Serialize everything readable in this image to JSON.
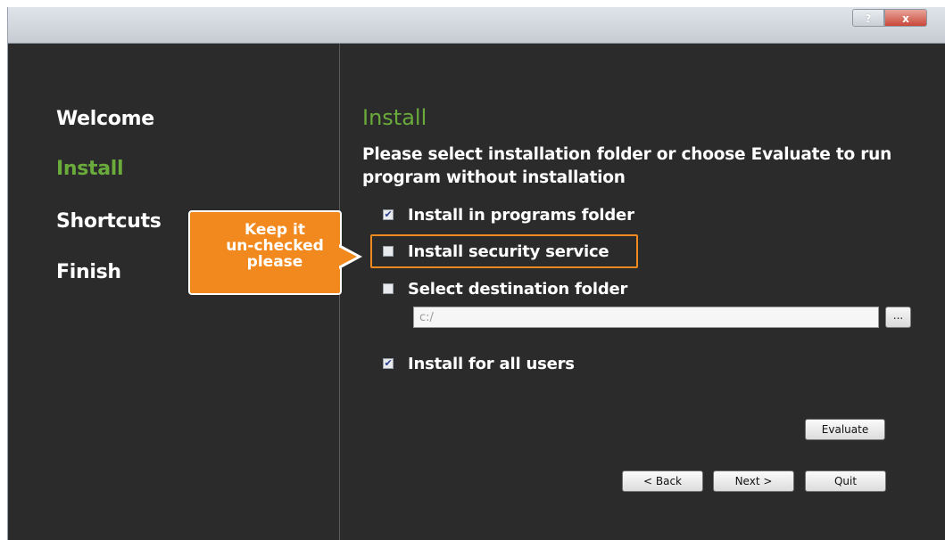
{
  "titlebar": {
    "help_label": "?",
    "close_label": "x"
  },
  "sidebar": {
    "items": [
      {
        "label": "Welcome",
        "active": false
      },
      {
        "label": "Install",
        "active": true
      },
      {
        "label": "Shortcuts",
        "active": false
      },
      {
        "label": "Finish",
        "active": false
      }
    ]
  },
  "main": {
    "title": "Install",
    "description": "Please select installation folder or choose Evaluate to run program without installation",
    "options": [
      {
        "label": "Install in programs folder",
        "checked": true
      },
      {
        "label": "Install security service",
        "checked": false
      },
      {
        "label": "Select destination folder",
        "checked": false
      },
      {
        "label": "Install for all users",
        "checked": true
      }
    ],
    "folder_value": "c:/",
    "browse_label": "...",
    "evaluate_label": "Evaluate",
    "back_label": "< Back",
    "next_label": "Next >",
    "quit_label": "Quit"
  },
  "annotation": {
    "lines": [
      "Keep it",
      "un-checked",
      "please"
    ],
    "color": "#f2891e"
  },
  "colors": {
    "accent_green": "#6aab3b",
    "background": "#2b2b2b",
    "highlight": "#f08a20"
  }
}
